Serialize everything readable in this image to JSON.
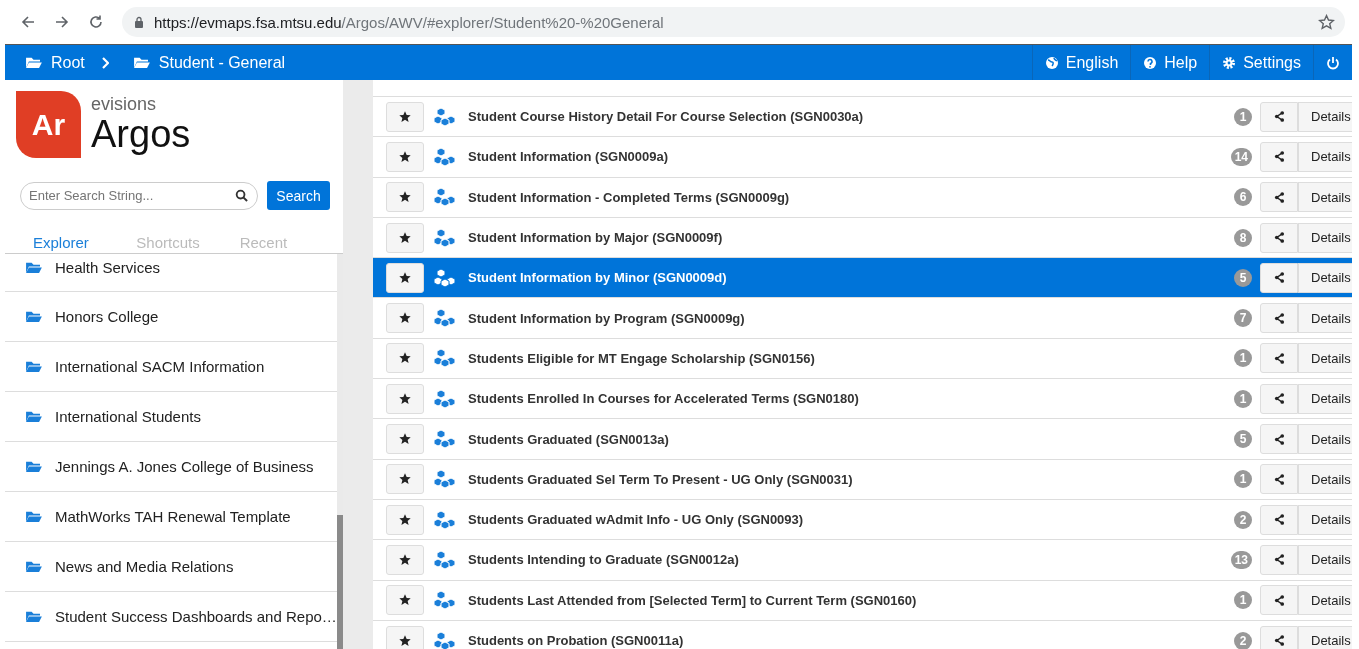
{
  "browser": {
    "url_host": "https://evmaps.fsa.mtsu.edu",
    "url_path": "/Argos/AWV/#explorer/Student%20-%20General"
  },
  "breadcrumbs": [
    {
      "label": "Root"
    },
    {
      "label": "Student - General"
    }
  ],
  "nav_actions": [
    {
      "kind": "globe",
      "label": "English"
    },
    {
      "kind": "help",
      "label": "Help"
    },
    {
      "kind": "gear",
      "label": "Settings"
    },
    {
      "kind": "power"
    }
  ],
  "logo": {
    "badge": "Ar",
    "brand": "evisions",
    "product": "Argos"
  },
  "search": {
    "placeholder": "Enter Search String...",
    "button": "Search"
  },
  "tabs": [
    {
      "label": "Explorer",
      "selected": true
    },
    {
      "label": "Shortcuts",
      "selected": false
    },
    {
      "label": "Recent",
      "selected": false
    }
  ],
  "folders": [
    {
      "label": "Health Services"
    },
    {
      "label": "Honors College"
    },
    {
      "label": "International SACM Information"
    },
    {
      "label": "International Students"
    },
    {
      "label": "Jennings A. Jones College of Business"
    },
    {
      "label": "MathWorks TAH Renewal Template"
    },
    {
      "label": "News and Media Relations"
    },
    {
      "label": "Student Success Dashboards and Repo…"
    }
  ],
  "reports": [
    {
      "title": "Student Course History Detail For Course Selection (SGN0030a)",
      "count": "1",
      "selected": false,
      "details": "Details"
    },
    {
      "title": "Student Information (SGN0009a)",
      "count": "14",
      "selected": false,
      "details": "Details"
    },
    {
      "title": "Student Information - Completed Terms (SGN0009g)",
      "count": "6",
      "selected": false,
      "details": "Details"
    },
    {
      "title": "Student Information by Major (SGN0009f)",
      "count": "8",
      "selected": false,
      "details": "Details"
    },
    {
      "title": "Student Information by Minor (SGN0009d)",
      "count": "5",
      "selected": true,
      "details": "Details"
    },
    {
      "title": "Student Information by Program (SGN0009g)",
      "count": "7",
      "selected": false,
      "details": "Details"
    },
    {
      "title": "Students Eligible for MT Engage Scholarship (SGN0156)",
      "count": "1",
      "selected": false,
      "details": "Details"
    },
    {
      "title": "Students Enrolled In Courses for Accelerated Terms (SGN0180)",
      "count": "1",
      "selected": false,
      "details": "Details"
    },
    {
      "title": "Students Graduated (SGN0013a)",
      "count": "5",
      "selected": false,
      "details": "Details"
    },
    {
      "title": "Students Graduated Sel Term To Present - UG Only (SGN0031)",
      "count": "1",
      "selected": false,
      "details": "Details"
    },
    {
      "title": "Students Graduated wAdmit Info - UG Only (SGN0093)",
      "count": "2",
      "selected": false,
      "details": "Details"
    },
    {
      "title": "Students Intending to Graduate (SGN0012a)",
      "count": "13",
      "selected": false,
      "details": "Details"
    },
    {
      "title": "Students Last Attended from [Selected Term] to Current Term (SGN0160)",
      "count": "1",
      "selected": false,
      "details": "Details"
    },
    {
      "title": "Students on Probation (SGN0011a)",
      "count": "2",
      "selected": false,
      "details": "Details"
    }
  ]
}
